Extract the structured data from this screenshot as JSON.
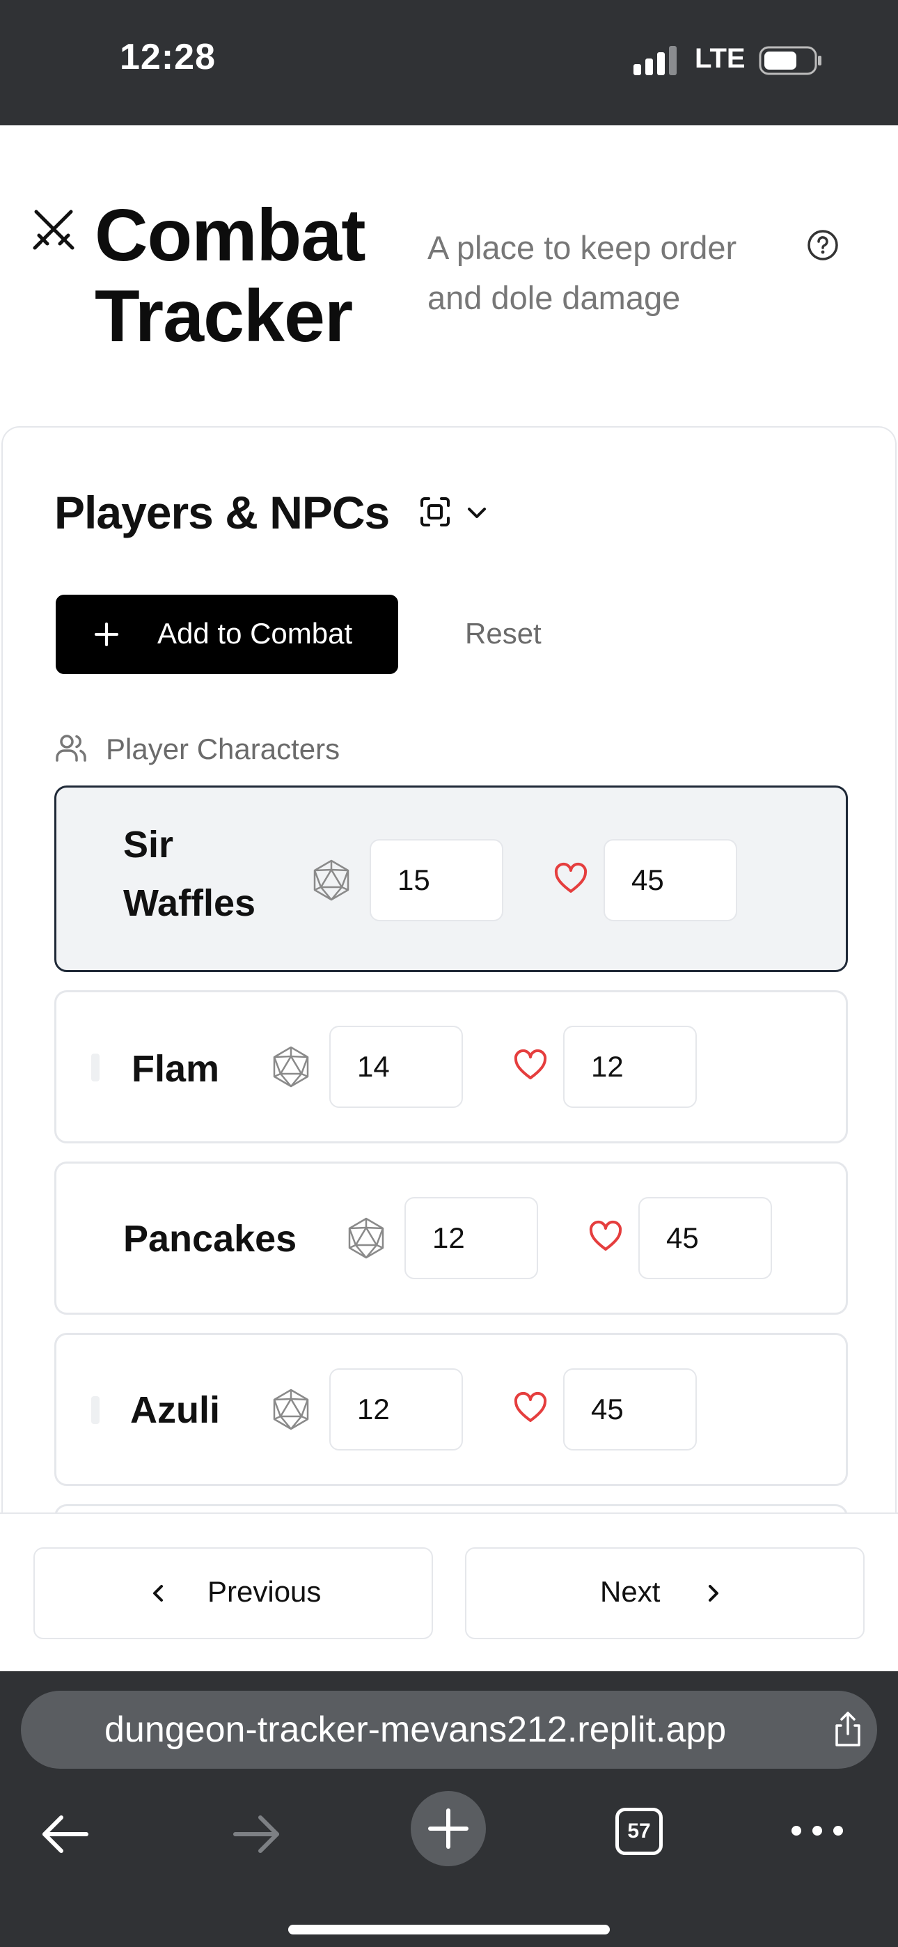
{
  "status_bar": {
    "time": "12:28",
    "network": "LTE"
  },
  "header": {
    "title": "Combat Tracker",
    "subtitle": "A place to keep order and dole damage",
    "icon": "crossed-swords-icon"
  },
  "section": {
    "title": "Players & NPCs",
    "add_button_label": "Add to Combat",
    "reset_label": "Reset",
    "group_label": "Player Characters"
  },
  "players": [
    {
      "name": "Sir Waffles",
      "initiative": "15",
      "hp": "45",
      "active": true
    },
    {
      "name": "Flam",
      "initiative": "14",
      "hp": "12",
      "active": false
    },
    {
      "name": "Pancakes",
      "initiative": "12",
      "hp": "45",
      "active": false
    },
    {
      "name": "Azuli",
      "initiative": "12",
      "hp": "45",
      "active": false
    }
  ],
  "footer": {
    "previous_label": "Previous",
    "next_label": "Next"
  },
  "browser": {
    "url": "dungeon-tracker-mevans212.replit.app",
    "tab_count": "57"
  },
  "colors": {
    "heart": "#e53e3e",
    "primary_button": "#000000",
    "chrome": "#303235"
  }
}
